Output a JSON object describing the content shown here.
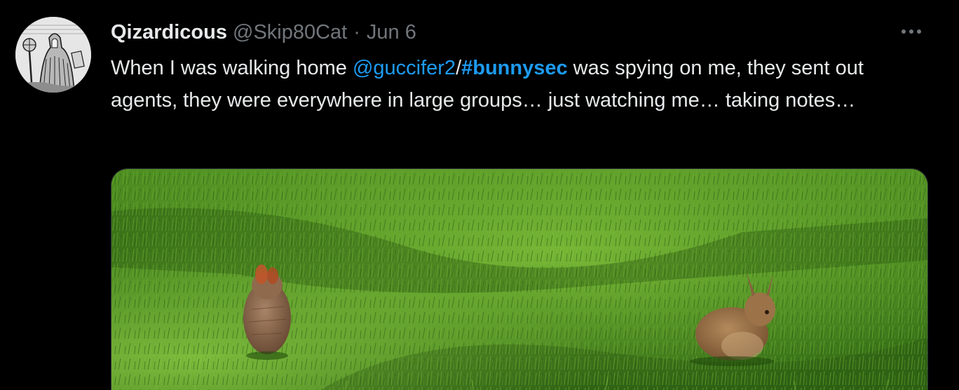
{
  "tweet": {
    "author": {
      "display_name": "Qizardicous",
      "handle": "@Skip80Cat",
      "avatar_icon": "avatar-engraving-icon"
    },
    "separator": "·",
    "date": "Jun 6",
    "more_icon": "more-options-icon",
    "text": {
      "part1": "When I was walking home ",
      "mention": "@guccifer2",
      "slash": "/",
      "hashtag": "#bunnysec",
      "part2": " was spying on me, they sent out agents, they were everywhere in large groups… just watching me… taking notes…"
    },
    "media": {
      "kind": "photo"
    }
  },
  "colors": {
    "background": "#000000",
    "text_primary": "#e7e9ea",
    "text_secondary": "#71767b",
    "accent": "#1d9bf0"
  }
}
